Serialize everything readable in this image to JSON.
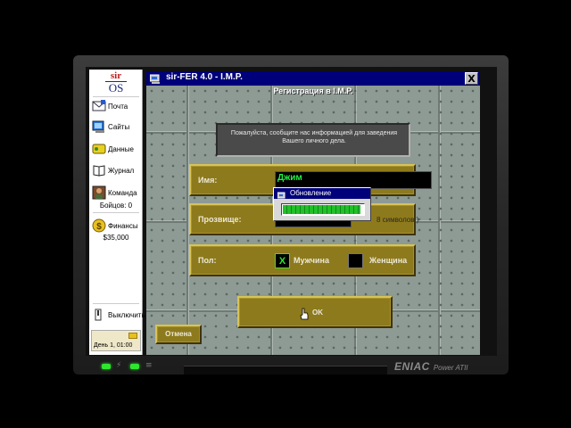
{
  "sidebar": {
    "logo_top": "sir",
    "logo_bottom": "OS",
    "items": [
      {
        "label": "Почта",
        "icon": "mail-icon"
      },
      {
        "label": "Сайты",
        "icon": "web-sites-icon"
      },
      {
        "label": "Данные",
        "icon": "data-icon"
      },
      {
        "label": "Журнал",
        "icon": "journal-book-icon"
      },
      {
        "label": "Команда",
        "icon": "team-portrait-icon"
      },
      {
        "label": "Финансы",
        "icon": "finance-money-icon"
      },
      {
        "label": "Выключить",
        "icon": "power-off-icon"
      }
    ],
    "team_count": "Бойцов: 0",
    "balance": "$35,000",
    "day_time": "День 1, 01:00"
  },
  "window": {
    "title": "sir-FER 4.0   -   I.M.P.",
    "close_label": "X"
  },
  "form": {
    "heading": "Регистрация в I.M.P.",
    "info_text": "Пожалуйста, сообщите нас информацией для заведения Вашего личного дела.",
    "name_label": "Имя:",
    "name_value": "Джим",
    "nickname_label": "Прозвище:",
    "nickname_hint": "8 символов )",
    "gender_label": "Пол:",
    "male_label": "Мужчина",
    "male_mark": "X",
    "female_label": "Женщина",
    "ok_label": "OK",
    "cancel_label": "Отмена"
  },
  "popup": {
    "title": "Обновление",
    "progress": 0.97
  },
  "device": {
    "brand": "ENIAC",
    "model": "Power ATII",
    "status_glyph_1": "⚡",
    "status_glyph_2": "≡"
  },
  "colors": {
    "title_bar": "#00007a",
    "input_text": "#22ee44",
    "panel_gold": "#8d7a1c",
    "progress_green": "#22c02a"
  }
}
